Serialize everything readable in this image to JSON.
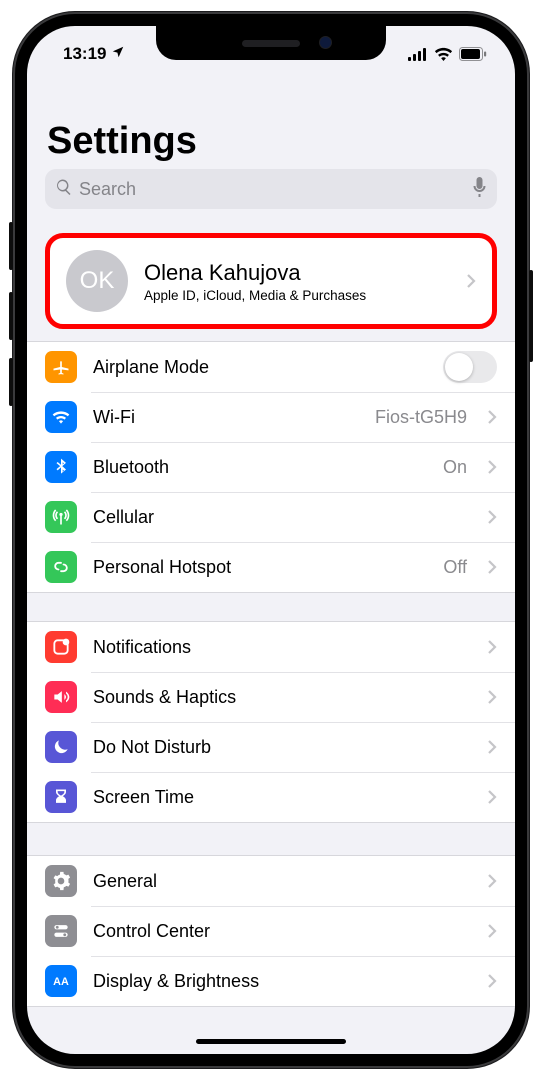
{
  "status": {
    "time": "13:19",
    "location_icon": "location-arrow-icon",
    "cellular": "signal-icon",
    "wifi": "wifi-icon",
    "battery": "battery-icon"
  },
  "header": {
    "title": "Settings"
  },
  "search": {
    "placeholder": "Search"
  },
  "profile": {
    "avatar_initials": "OK",
    "name": "Olena Kahujova",
    "subtitle": "Apple ID, iCloud, Media & Purchases",
    "highlighted": true
  },
  "groups": [
    {
      "rows": [
        {
          "icon": "airplane-icon",
          "icon_bg": "#ff9500",
          "label": "Airplane Mode",
          "type": "toggle",
          "toggled": false
        },
        {
          "icon": "wifi-icon",
          "icon_bg": "#007aff",
          "label": "Wi-Fi",
          "detail": "Fios-tG5H9",
          "type": "link"
        },
        {
          "icon": "bluetooth-icon",
          "icon_bg": "#007aff",
          "label": "Bluetooth",
          "detail": "On",
          "type": "link"
        },
        {
          "icon": "antenna-icon",
          "icon_bg": "#34c759",
          "label": "Cellular",
          "detail": "",
          "type": "link"
        },
        {
          "icon": "hotspot-icon",
          "icon_bg": "#34c759",
          "label": "Personal Hotspot",
          "detail": "Off",
          "type": "link"
        }
      ]
    },
    {
      "rows": [
        {
          "icon": "notifications-icon",
          "icon_bg": "#ff3b30",
          "label": "Notifications",
          "detail": "",
          "type": "link"
        },
        {
          "icon": "sounds-icon",
          "icon_bg": "#ff2d55",
          "label": "Sounds & Haptics",
          "detail": "",
          "type": "link"
        },
        {
          "icon": "moon-icon",
          "icon_bg": "#5856d6",
          "label": "Do Not Disturb",
          "detail": "",
          "type": "link"
        },
        {
          "icon": "hourglass-icon",
          "icon_bg": "#5856d6",
          "label": "Screen Time",
          "detail": "",
          "type": "link"
        }
      ]
    },
    {
      "rows": [
        {
          "icon": "gear-icon",
          "icon_bg": "#8e8e93",
          "label": "General",
          "detail": "",
          "type": "link"
        },
        {
          "icon": "switches-icon",
          "icon_bg": "#8e8e93",
          "label": "Control Center",
          "detail": "",
          "type": "link"
        },
        {
          "icon": "aa-icon",
          "icon_bg": "#007aff",
          "label": "Display & Brightness",
          "detail": "",
          "type": "link"
        }
      ]
    }
  ]
}
